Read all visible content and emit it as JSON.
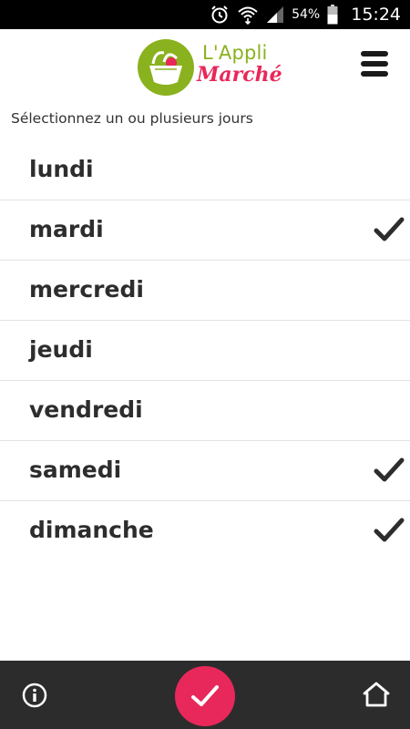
{
  "status_bar": {
    "battery_percent": "54%",
    "time": "15:24",
    "icons": [
      "alarm-icon",
      "wifi-icon",
      "signal-icon",
      "battery-icon"
    ]
  },
  "header": {
    "logo_line1": "L'Appli",
    "logo_line2": "Marché",
    "menu_icon": "hamburger-menu-icon"
  },
  "instruction": "Sélectionnez un ou plusieurs jours",
  "days": [
    {
      "label": "lundi",
      "selected": false
    },
    {
      "label": "mardi",
      "selected": true
    },
    {
      "label": "mercredi",
      "selected": false
    },
    {
      "label": "jeudi",
      "selected": false
    },
    {
      "label": "vendredi",
      "selected": false
    },
    {
      "label": "samedi",
      "selected": true
    },
    {
      "label": "dimanche",
      "selected": true
    }
  ],
  "bottom_bar": {
    "info_icon": "info-icon",
    "confirm_icon": "check-icon",
    "home_icon": "home-icon"
  },
  "colors": {
    "accent": "#e8285a",
    "logo_green": "#8ab21e",
    "bottom_bar": "#2c2c2c"
  }
}
